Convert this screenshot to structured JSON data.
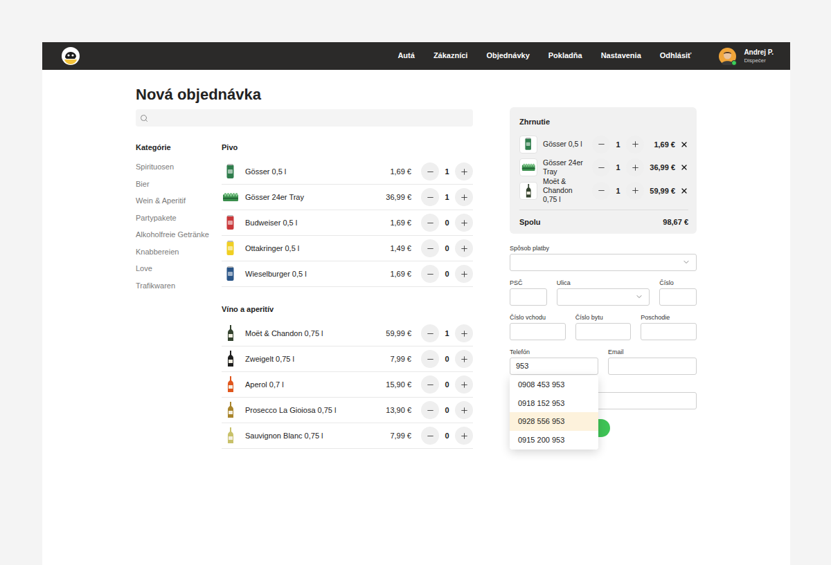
{
  "header": {
    "nav": [
      {
        "label": "Autá",
        "selected": false
      },
      {
        "label": "Zákazníci",
        "selected": false
      },
      {
        "label": "Objednávky",
        "selected": false
      },
      {
        "label": "Pokladňa",
        "selected": false
      },
      {
        "label": "Nastavenia",
        "selected": false
      },
      {
        "label": "Odhlásiť",
        "selected": false
      }
    ],
    "user": {
      "name": "Andrej P.",
      "role": "Dispečer",
      "online": true
    }
  },
  "page": {
    "title": "Nová objednávka"
  },
  "search": {
    "placeholder": ""
  },
  "categories": {
    "title": "Kategórie",
    "items": [
      {
        "label": "Spirituosen",
        "selected": false
      },
      {
        "label": "Bier",
        "selected": false
      },
      {
        "label": "Wein & Aperitif",
        "selected": false
      },
      {
        "label": "Partypakete",
        "selected": false
      },
      {
        "label": "Alkoholfreie Getränke",
        "selected": false
      },
      {
        "label": "Knabbereien",
        "selected": false
      },
      {
        "label": "Love",
        "selected": false
      },
      {
        "label": "Trafikwaren",
        "selected": false
      }
    ]
  },
  "sections": [
    {
      "title": "Pivo",
      "products": [
        {
          "name": "Gösser 0,5 l",
          "price": "1,69 €",
          "qty": "1",
          "kind": "can",
          "color": "#2f7d4c"
        },
        {
          "name": "Gösser 24er Tray",
          "price": "36,99 €",
          "qty": "1",
          "kind": "tray",
          "color": "#3b8f4d"
        },
        {
          "name": "Budweiser 0,5 l",
          "price": "1,69 €",
          "qty": "0",
          "kind": "can",
          "color": "#c9383a"
        },
        {
          "name": "Ottakringer 0,5 l",
          "price": "1,49 €",
          "qty": "0",
          "kind": "can",
          "color": "#f0cf22"
        },
        {
          "name": "Wieselburger 0,5 l",
          "price": "1,69 €",
          "qty": "0",
          "kind": "can",
          "color": "#2a5587"
        }
      ]
    },
    {
      "title": "Víno a aperitív",
      "products": [
        {
          "name": "Moët & Chandon 0,75 l",
          "price": "59,99 €",
          "qty": "1",
          "kind": "bottle",
          "color": "#34432f"
        },
        {
          "name": "Zweigelt 0,75 l",
          "price": "7,99 €",
          "qty": "0",
          "kind": "bottle",
          "color": "#1f1f1f"
        },
        {
          "name": "Aperol 0,7 l",
          "price": "15,90 €",
          "qty": "0",
          "kind": "bottle",
          "color": "#e0561c"
        },
        {
          "name": "Prosecco La Gioiosa 0,75 l",
          "price": "13,90 €",
          "qty": "0",
          "kind": "bottle",
          "color": "#a9852c"
        },
        {
          "name": "Sauvignon Blanc 0,75 l",
          "price": "7,99 €",
          "qty": "0",
          "kind": "bottle",
          "color": "#c8c16a"
        }
      ]
    }
  ],
  "summary": {
    "title": "Zhrnutie",
    "items": [
      {
        "name": "Gösser 0,5 l",
        "qty": "1",
        "price": "1,69 €",
        "kind": "can",
        "color": "#2f7d4c"
      },
      {
        "name": "Gösser 24er Tray",
        "qty": "1",
        "price": "36,99 €",
        "kind": "tray",
        "color": "#3b8f4d"
      },
      {
        "name": "Moët & Chandon 0,75 l",
        "qty": "1",
        "price": "59,99 €",
        "kind": "bottle",
        "color": "#34432f"
      }
    ],
    "total_label": "Spolu",
    "total": "98,67 €"
  },
  "form": {
    "rows": [
      [
        {
          "label": "Spôsob platby",
          "value": "",
          "kind": "select"
        }
      ],
      [
        {
          "label": "PSČ",
          "value": "",
          "kind": "input"
        },
        {
          "label": "Ulica",
          "value": "",
          "kind": "select"
        },
        {
          "label": "Číslo",
          "value": "",
          "kind": "input"
        }
      ],
      [
        {
          "label": "Číslo vchodu",
          "value": "",
          "kind": "input"
        },
        {
          "label": "Číslo bytu",
          "value": "",
          "kind": "input"
        },
        {
          "label": "Poschodie",
          "value": "",
          "kind": "input"
        }
      ],
      [
        {
          "label": "Telefón",
          "value": "953",
          "kind": "phone"
        },
        {
          "label": "Email",
          "value": "",
          "kind": "input"
        }
      ],
      [
        {
          "label": "",
          "value": "",
          "kind": "input"
        }
      ]
    ],
    "phone_suggestions": [
      {
        "number": "0908 453 953",
        "selected": false
      },
      {
        "number": "0918 152 953",
        "selected": false
      },
      {
        "number": "0928 556 953",
        "selected": true
      },
      {
        "number": "0915 200 953",
        "selected": false
      }
    ]
  }
}
